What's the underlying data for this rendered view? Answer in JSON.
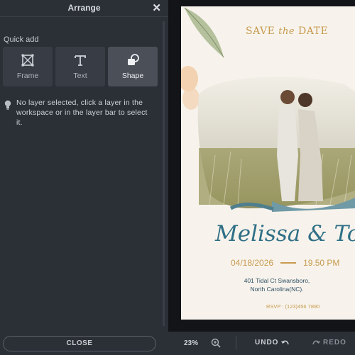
{
  "panel": {
    "title": "Arrange",
    "section_label": "Quick add",
    "tools": [
      {
        "label": "Frame",
        "icon": "frame-icon"
      },
      {
        "label": "Text",
        "icon": "text-icon"
      },
      {
        "label": "Shape",
        "icon": "shape-icon",
        "active": true
      }
    ],
    "hint": "No layer selected, click a layer in the workspace or in the layer bar to select it.",
    "close_label": "CLOSE"
  },
  "canvas": {
    "heading_left": "SAVE",
    "heading_mid": "the",
    "heading_right": "DATE",
    "names": "Melissa & Tom",
    "date": "04/18/2026",
    "time": "19.50 PM",
    "address_line1": "401 Tidal Ct Swansboro,",
    "address_line2": "North Carolina(NC).",
    "rsvp": "RSVP : (123)456 7890"
  },
  "toolbar": {
    "zoom": "23%",
    "undo_label": "UNDO",
    "redo_label": "REDO"
  },
  "colors": {
    "panel_bg": "#2b2f36",
    "workspace_bg": "#121417",
    "gold": "#c89a4e",
    "teal": "#2f6f86"
  }
}
